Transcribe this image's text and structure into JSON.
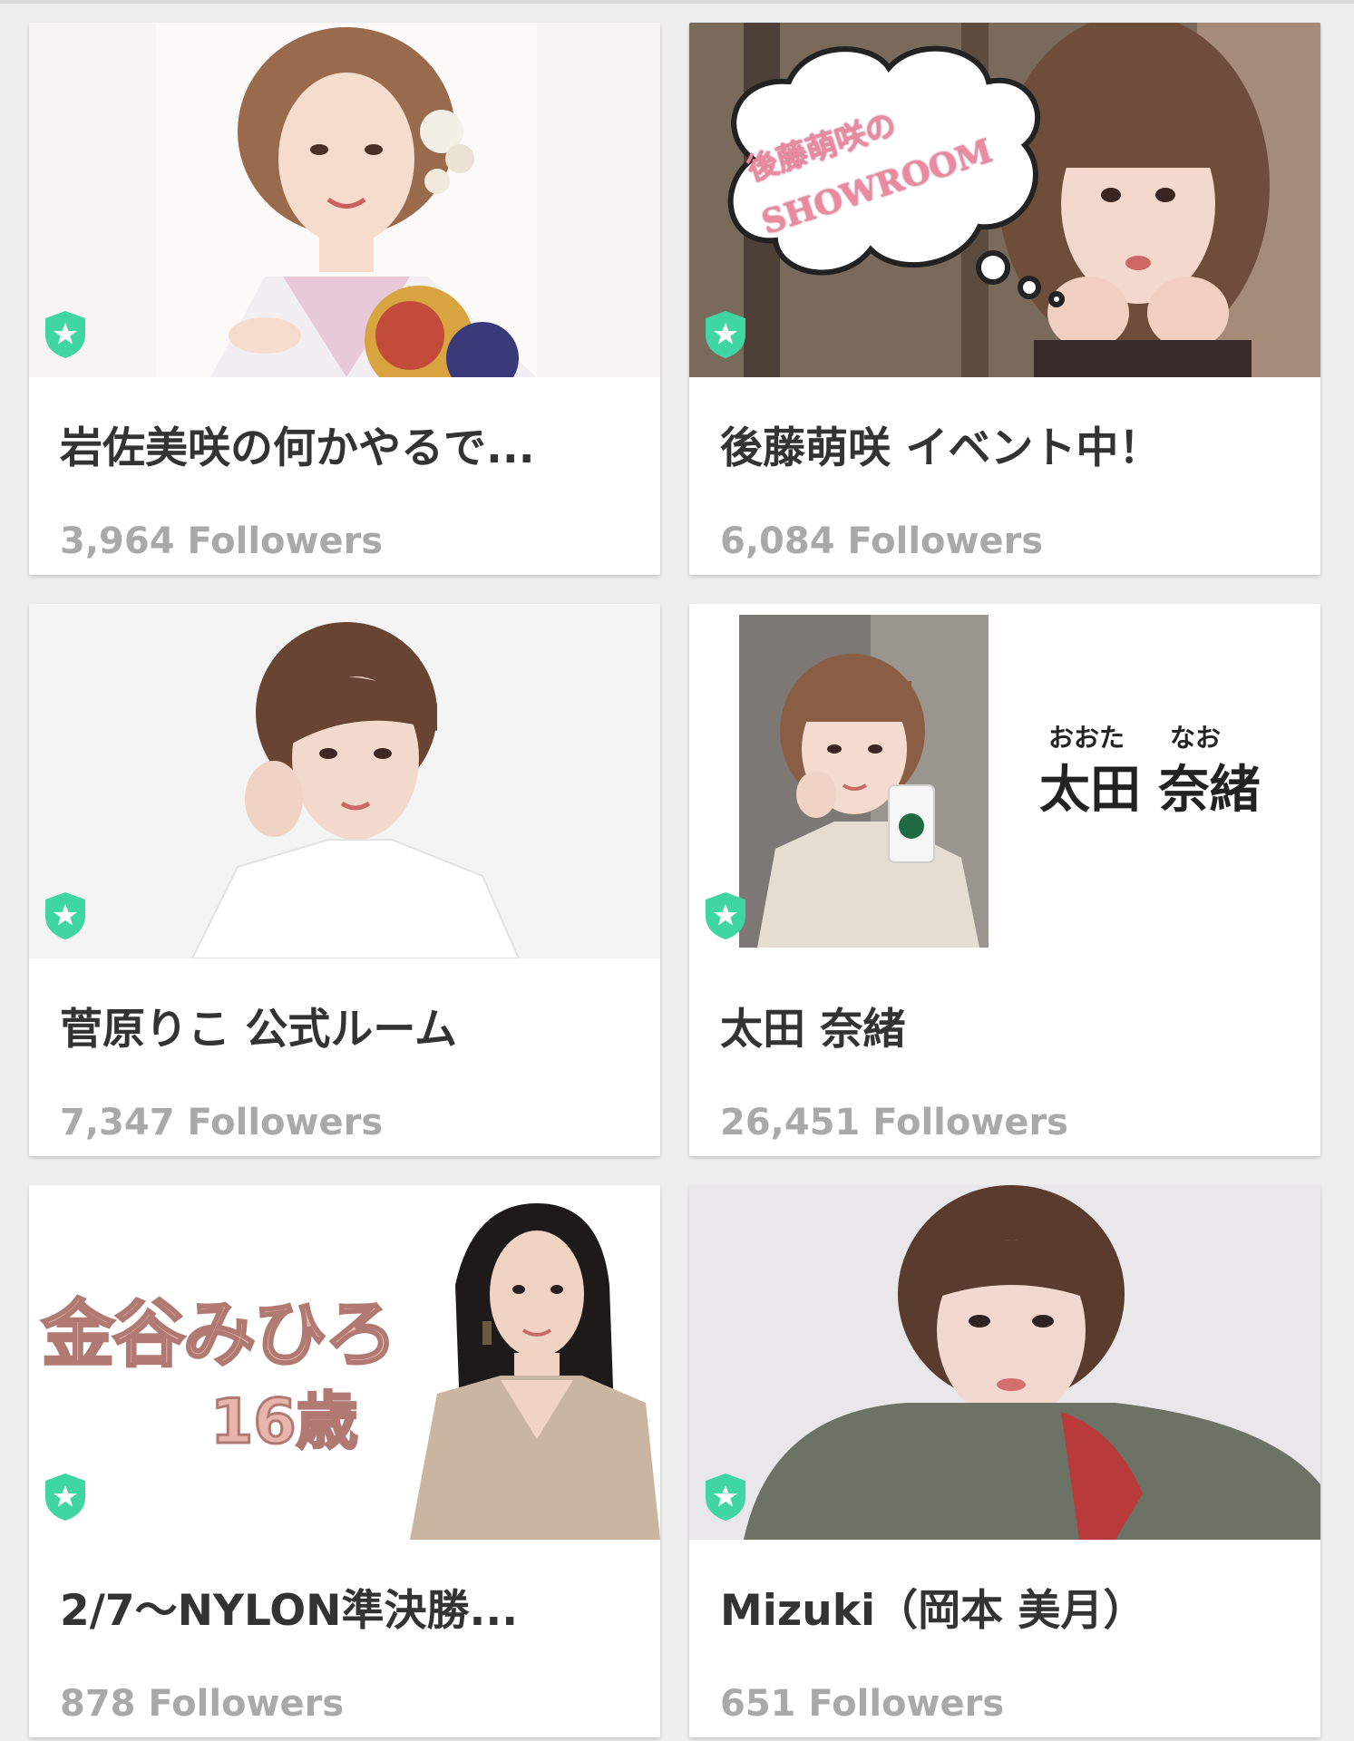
{
  "accent_color": "#3fd6a4",
  "rooms": [
    {
      "title": "岩佐美咲の何かやるで...",
      "followers": "3,964 Followers",
      "badge_icon": "shield-star-icon",
      "image": "portrait-kimono"
    },
    {
      "title": "後藤萌咲 イベント中！",
      "followers": "6,084 Followers",
      "badge_icon": "shield-star-icon",
      "image": "portrait-speech-bubble",
      "image_text": {
        "line1": "後藤萌咲の",
        "line2": "SHOWROOM"
      }
    },
    {
      "title": "菅原りこ 公式ルーム",
      "followers": "7,347 Followers",
      "badge_icon": "shield-star-icon",
      "image": "portrait-short-hair"
    },
    {
      "title": "太田 奈緒",
      "followers": "26,451 Followers",
      "badge_icon": "shield-star-icon",
      "image": "portrait-with-name",
      "image_text": {
        "ruby_left": "おおた",
        "ruby_right": "なお",
        "name": "太田 奈緒"
      }
    },
    {
      "title": "2/7〜NYLON準決勝...",
      "followers": "878 Followers",
      "badge_icon": "shield-star-icon",
      "image": "portrait-with-caption",
      "image_text": {
        "name": "金谷みひろ",
        "age": "16歳"
      }
    },
    {
      "title": "Mizuki（岡本 美月）",
      "followers": "651 Followers",
      "badge_icon": "shield-star-icon",
      "image": "portrait-hoodie"
    }
  ]
}
